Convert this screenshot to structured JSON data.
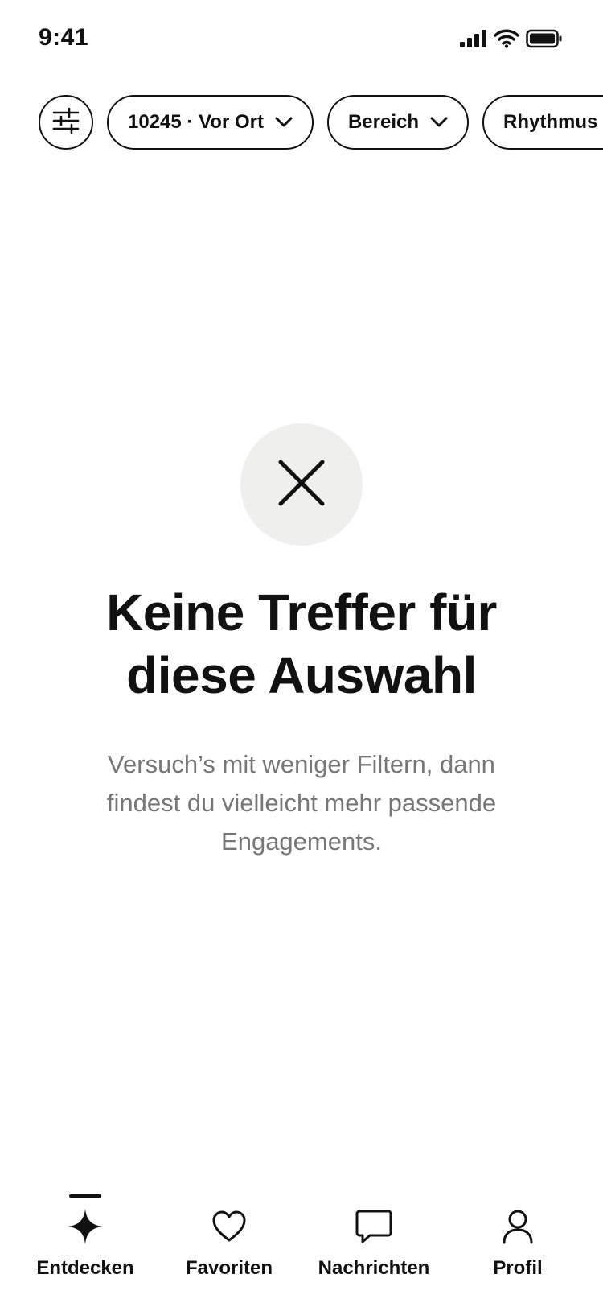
{
  "status_bar": {
    "time": "9:41",
    "icons": [
      "cellular-signal-icon",
      "wifi-icon",
      "battery-icon"
    ]
  },
  "filters": {
    "settings_icon": "sliders-icon",
    "chips": [
      {
        "label": "10245 · Vor Ort",
        "icon": "chevron-down-icon"
      },
      {
        "label": "Bereich",
        "icon": "chevron-down-icon"
      },
      {
        "label": "Rhythmus",
        "icon": "chevron-down-icon"
      }
    ]
  },
  "empty_state": {
    "icon": "close-icon",
    "title": "Keine Treffer für diese Auswahl",
    "body": "Versuch’s mit weniger Filtern, dann findest du vielleicht mehr passende Engagements."
  },
  "tabbar": {
    "items": [
      {
        "label": "Entdecken",
        "icon": "sparkle-icon",
        "active": true
      },
      {
        "label": "Favoriten",
        "icon": "heart-icon",
        "active": false
      },
      {
        "label": "Nachrichten",
        "icon": "message-bubble-icon",
        "active": false
      },
      {
        "label": "Profil",
        "icon": "person-icon",
        "active": false
      }
    ]
  },
  "colors": {
    "text": "#111111",
    "muted_text": "#777777",
    "icon_circle_bg": "#efefed",
    "background": "#ffffff"
  }
}
